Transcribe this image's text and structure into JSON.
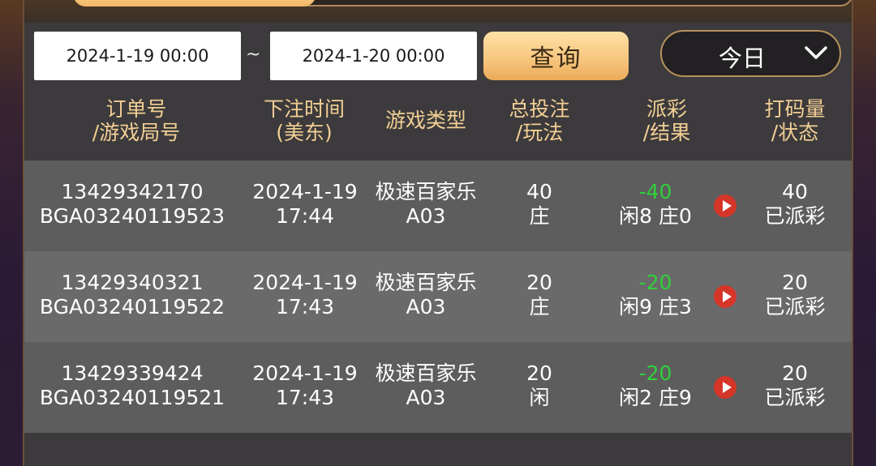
{
  "filters": {
    "start_date": "2024-1-19 00:00",
    "end_date": "2024-1-20 00:00",
    "separator": "~",
    "query_label": "查询",
    "period_label": "今日"
  },
  "table": {
    "headers": [
      {
        "line1": "订单号",
        "line2": "/游戏局号"
      },
      {
        "line1": "下注时间",
        "line2": "(美东)"
      },
      {
        "line1": "游戏类型",
        "line2": ""
      },
      {
        "line1": "总投注",
        "line2": "/玩法"
      },
      {
        "line1": "派彩",
        "line2": "/结果"
      },
      {
        "line1": "打码量",
        "line2": "/状态"
      }
    ],
    "rows": [
      {
        "order_no": "13429342170",
        "round_no": "BGA03240119523",
        "date": "2024-1-19",
        "time": "17:44",
        "game": "极速百家乐",
        "table": "A03",
        "bet": "40",
        "play": "庄",
        "payout": "-40",
        "result": "闲8 庄0",
        "turnover": "40",
        "status": "已派彩"
      },
      {
        "order_no": "13429340321",
        "round_no": "BGA03240119522",
        "date": "2024-1-19",
        "time": "17:43",
        "game": "极速百家乐",
        "table": "A03",
        "bet": "20",
        "play": "庄",
        "payout": "-20",
        "result": "闲9 庄3",
        "turnover": "20",
        "status": "已派彩"
      },
      {
        "order_no": "13429339424",
        "round_no": "BGA03240119521",
        "date": "2024-1-19",
        "time": "17:43",
        "game": "极速百家乐",
        "table": "A03",
        "bet": "20",
        "play": "闲",
        "payout": "-20",
        "result": "闲2 庄9",
        "turnover": "20",
        "status": "已派彩"
      }
    ]
  },
  "colors": {
    "accent_gold": "#f2cf94",
    "payout_green": "#2fd03a",
    "play_red": "#d63628"
  }
}
